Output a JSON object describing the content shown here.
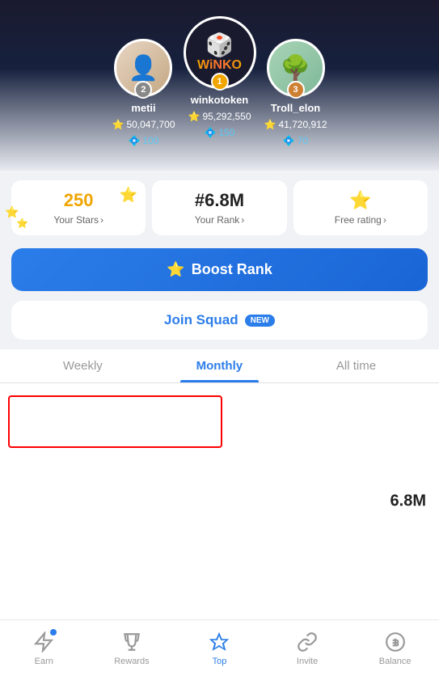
{
  "header": {
    "background": "#1a1a2e"
  },
  "leaderboard": {
    "players": [
      {
        "rank": 1,
        "username": "winkotoken",
        "stars": "95,292,550",
        "diamonds": "150",
        "badge": "1",
        "avatar_type": "logo"
      },
      {
        "rank": 2,
        "username": "metii",
        "stars": "50,047,700",
        "diamonds": "100",
        "badge": "2",
        "avatar_type": "person"
      },
      {
        "rank": 3,
        "username": "Troll_elon",
        "stars": "41,720,912",
        "diamonds": "70",
        "badge": "3",
        "avatar_type": "bonsai"
      }
    ]
  },
  "stats": {
    "your_stars": {
      "value": "250",
      "label": "Your Stars",
      "chevron": ">"
    },
    "your_rank": {
      "value": "#6.8M",
      "label": "Your Rank",
      "chevron": ">"
    },
    "free_rating": {
      "label": "Free rating",
      "chevron": ">"
    }
  },
  "boost_btn": {
    "label": "Boost Rank"
  },
  "join_squad": {
    "label": "Join Squad",
    "badge": "NEW"
  },
  "tabs": [
    {
      "id": "weekly",
      "label": "Weekly",
      "active": false
    },
    {
      "id": "monthly",
      "label": "Monthly",
      "active": true
    },
    {
      "id": "alltime",
      "label": "All time",
      "active": false
    }
  ],
  "content": {
    "rank_value": "6.8M"
  },
  "bottom_nav": [
    {
      "id": "earn",
      "label": "Earn",
      "icon": "lightning",
      "active": false,
      "has_dot": true
    },
    {
      "id": "rewards",
      "label": "Rewards",
      "icon": "trophy",
      "active": false,
      "has_dot": false
    },
    {
      "id": "top",
      "label": "Top",
      "icon": "top-star",
      "active": true,
      "has_dot": false
    },
    {
      "id": "invite",
      "label": "Invite",
      "icon": "link",
      "active": false,
      "has_dot": false
    },
    {
      "id": "balance",
      "label": "Balance",
      "icon": "dollar",
      "active": false,
      "has_dot": false
    }
  ]
}
